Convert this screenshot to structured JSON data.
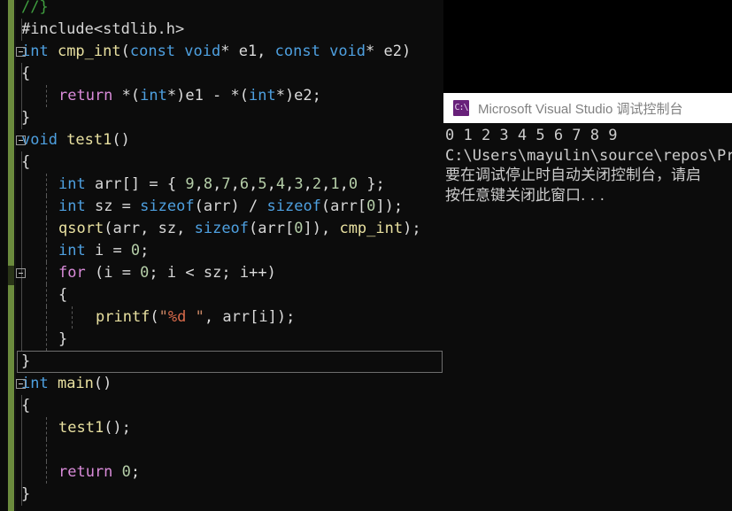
{
  "editor": {
    "name": "visual-studio-code-editor",
    "background": "#0c0c0c",
    "change_bar_color": "#6b8b3d",
    "lines": [
      {
        "id": "l01",
        "indent": 0,
        "fold": false,
        "guides": [],
        "current": false,
        "tokens": [
          {
            "t": "//}",
            "c": "c-comment"
          }
        ]
      },
      {
        "id": "l02",
        "indent": 0,
        "fold": false,
        "guides": [
          "g1"
        ],
        "current": false,
        "tokens": [
          {
            "t": "#include<stdlib.h>",
            "c": "c-pre"
          }
        ]
      },
      {
        "id": "l03",
        "indent": 0,
        "fold": true,
        "guides": [],
        "current": false,
        "tokens": [
          {
            "t": "int ",
            "c": "c-kw"
          },
          {
            "t": "cmp_int",
            "c": "c-fn"
          },
          {
            "t": "(",
            "c": "c-punc"
          },
          {
            "t": "const ",
            "c": "c-kw"
          },
          {
            "t": "void",
            "c": "c-kw"
          },
          {
            "t": "* e1, ",
            "c": "c-plain"
          },
          {
            "t": "const ",
            "c": "c-kw"
          },
          {
            "t": "void",
            "c": "c-kw"
          },
          {
            "t": "* e2)",
            "c": "c-plain"
          }
        ]
      },
      {
        "id": "l04",
        "indent": 0,
        "fold": false,
        "guides": [
          "g1"
        ],
        "current": false,
        "tokens": [
          {
            "t": "{",
            "c": "c-plain"
          }
        ]
      },
      {
        "id": "l05",
        "indent": 2,
        "fold": false,
        "guides": [
          "g1",
          "g2d"
        ],
        "current": false,
        "tokens": [
          {
            "t": "return ",
            "c": "c-ctrl"
          },
          {
            "t": "*(",
            "c": "c-plain"
          },
          {
            "t": "int",
            "c": "c-kw"
          },
          {
            "t": "*)e1 - *(",
            "c": "c-plain"
          },
          {
            "t": "int",
            "c": "c-kw"
          },
          {
            "t": "*)e2;",
            "c": "c-plain"
          }
        ]
      },
      {
        "id": "l06",
        "indent": 0,
        "fold": false,
        "guides": [
          "g1"
        ],
        "current": false,
        "tokens": [
          {
            "t": "}",
            "c": "c-plain"
          }
        ]
      },
      {
        "id": "l07",
        "indent": 0,
        "fold": true,
        "guides": [],
        "current": false,
        "tokens": [
          {
            "t": "void ",
            "c": "c-kw"
          },
          {
            "t": "test1",
            "c": "c-fn"
          },
          {
            "t": "()",
            "c": "c-plain"
          }
        ]
      },
      {
        "id": "l08",
        "indent": 0,
        "fold": false,
        "guides": [
          "g1"
        ],
        "current": false,
        "tokens": [
          {
            "t": "{",
            "c": "c-plain"
          }
        ]
      },
      {
        "id": "l09",
        "indent": 2,
        "fold": false,
        "guides": [
          "g1",
          "g2d"
        ],
        "current": false,
        "tokens": [
          {
            "t": "int ",
            "c": "c-kw"
          },
          {
            "t": "arr",
            "c": "c-var"
          },
          {
            "t": "[] = { ",
            "c": "c-plain"
          },
          {
            "t": "9",
            "c": "c-num"
          },
          {
            "t": ",",
            "c": "c-plain"
          },
          {
            "t": "8",
            "c": "c-num"
          },
          {
            "t": ",",
            "c": "c-plain"
          },
          {
            "t": "7",
            "c": "c-num"
          },
          {
            "t": ",",
            "c": "c-plain"
          },
          {
            "t": "6",
            "c": "c-num"
          },
          {
            "t": ",",
            "c": "c-plain"
          },
          {
            "t": "5",
            "c": "c-num"
          },
          {
            "t": ",",
            "c": "c-plain"
          },
          {
            "t": "4",
            "c": "c-num"
          },
          {
            "t": ",",
            "c": "c-plain"
          },
          {
            "t": "3",
            "c": "c-num"
          },
          {
            "t": ",",
            "c": "c-plain"
          },
          {
            "t": "2",
            "c": "c-num"
          },
          {
            "t": ",",
            "c": "c-plain"
          },
          {
            "t": "1",
            "c": "c-num"
          },
          {
            "t": ",",
            "c": "c-plain"
          },
          {
            "t": "0",
            "c": "c-num"
          },
          {
            "t": " };",
            "c": "c-plain"
          }
        ]
      },
      {
        "id": "l10",
        "indent": 2,
        "fold": false,
        "guides": [
          "g1",
          "g2d"
        ],
        "current": false,
        "tokens": [
          {
            "t": "int ",
            "c": "c-kw"
          },
          {
            "t": "sz",
            "c": "c-var"
          },
          {
            "t": " = ",
            "c": "c-plain"
          },
          {
            "t": "sizeof",
            "c": "c-kw"
          },
          {
            "t": "(",
            "c": "c-plain"
          },
          {
            "t": "arr",
            "c": "c-var"
          },
          {
            "t": ") / ",
            "c": "c-plain"
          },
          {
            "t": "sizeof",
            "c": "c-kw"
          },
          {
            "t": "(",
            "c": "c-plain"
          },
          {
            "t": "arr",
            "c": "c-var"
          },
          {
            "t": "[",
            "c": "c-plain"
          },
          {
            "t": "0",
            "c": "c-num"
          },
          {
            "t": "]);",
            "c": "c-plain"
          }
        ]
      },
      {
        "id": "l11",
        "indent": 2,
        "fold": false,
        "guides": [
          "g1",
          "g2d"
        ],
        "current": false,
        "tokens": [
          {
            "t": "qsort",
            "c": "c-fn"
          },
          {
            "t": "(",
            "c": "c-plain"
          },
          {
            "t": "arr",
            "c": "c-var"
          },
          {
            "t": ", ",
            "c": "c-plain"
          },
          {
            "t": "sz",
            "c": "c-var"
          },
          {
            "t": ", ",
            "c": "c-plain"
          },
          {
            "t": "sizeof",
            "c": "c-kw"
          },
          {
            "t": "(",
            "c": "c-plain"
          },
          {
            "t": "arr",
            "c": "c-var"
          },
          {
            "t": "[",
            "c": "c-plain"
          },
          {
            "t": "0",
            "c": "c-num"
          },
          {
            "t": "]), ",
            "c": "c-plain"
          },
          {
            "t": "cmp_int",
            "c": "c-fn"
          },
          {
            "t": ");",
            "c": "c-plain"
          }
        ]
      },
      {
        "id": "l12",
        "indent": 2,
        "fold": false,
        "guides": [
          "g1",
          "g2d"
        ],
        "current": false,
        "tokens": [
          {
            "t": "int ",
            "c": "c-kw"
          },
          {
            "t": "i",
            "c": "c-var"
          },
          {
            "t": " = ",
            "c": "c-plain"
          },
          {
            "t": "0",
            "c": "c-num"
          },
          {
            "t": ";",
            "c": "c-plain"
          }
        ]
      },
      {
        "id": "l13",
        "indent": 2,
        "fold": true,
        "guides": [
          "g1",
          "g2d"
        ],
        "current": false,
        "tokens": [
          {
            "t": "for ",
            "c": "c-ctrl"
          },
          {
            "t": "(",
            "c": "c-plain"
          },
          {
            "t": "i",
            "c": "c-var"
          },
          {
            "t": " = ",
            "c": "c-plain"
          },
          {
            "t": "0",
            "c": "c-num"
          },
          {
            "t": "; ",
            "c": "c-plain"
          },
          {
            "t": "i",
            "c": "c-var"
          },
          {
            "t": " < ",
            "c": "c-plain"
          },
          {
            "t": "sz",
            "c": "c-var"
          },
          {
            "t": "; ",
            "c": "c-plain"
          },
          {
            "t": "i",
            "c": "c-var"
          },
          {
            "t": "++)",
            "c": "c-plain"
          }
        ]
      },
      {
        "id": "l14",
        "indent": 2,
        "fold": false,
        "guides": [
          "g1",
          "g2d"
        ],
        "current": false,
        "tokens": [
          {
            "t": "{",
            "c": "c-plain"
          }
        ]
      },
      {
        "id": "l15",
        "indent": 4,
        "fold": false,
        "guides": [
          "g1",
          "g2d",
          "g3d"
        ],
        "current": false,
        "tokens": [
          {
            "t": "printf",
            "c": "c-fn"
          },
          {
            "t": "(",
            "c": "c-plain"
          },
          {
            "t": "\"",
            "c": "c-str"
          },
          {
            "t": "%d",
            "c": "c-fmt"
          },
          {
            "t": " \"",
            "c": "c-str"
          },
          {
            "t": ", ",
            "c": "c-plain"
          },
          {
            "t": "arr",
            "c": "c-var"
          },
          {
            "t": "[",
            "c": "c-plain"
          },
          {
            "t": "i",
            "c": "c-var"
          },
          {
            "t": "]);",
            "c": "c-plain"
          }
        ]
      },
      {
        "id": "l16",
        "indent": 2,
        "fold": false,
        "guides": [
          "g1",
          "g2d"
        ],
        "current": false,
        "tokens": [
          {
            "t": "}",
            "c": "c-plain"
          }
        ]
      },
      {
        "id": "l17",
        "indent": 0,
        "fold": false,
        "guides": [],
        "current": true,
        "tokens": [
          {
            "t": "}",
            "c": "c-plain"
          }
        ]
      },
      {
        "id": "l18",
        "indent": 0,
        "fold": true,
        "guides": [],
        "current": false,
        "tokens": [
          {
            "t": "int ",
            "c": "c-kw"
          },
          {
            "t": "main",
            "c": "c-fn"
          },
          {
            "t": "()",
            "c": "c-plain"
          }
        ]
      },
      {
        "id": "l19",
        "indent": 0,
        "fold": false,
        "guides": [
          "g1"
        ],
        "current": false,
        "tokens": [
          {
            "t": "{",
            "c": "c-plain"
          }
        ]
      },
      {
        "id": "l20",
        "indent": 2,
        "fold": false,
        "guides": [
          "g1",
          "g2d"
        ],
        "current": false,
        "tokens": [
          {
            "t": "test1",
            "c": "c-fn"
          },
          {
            "t": "();",
            "c": "c-plain"
          }
        ]
      },
      {
        "id": "l21",
        "indent": 0,
        "fold": false,
        "guides": [
          "g1",
          "g2d"
        ],
        "current": false,
        "tokens": [
          {
            "t": "",
            "c": "c-plain"
          }
        ]
      },
      {
        "id": "l22",
        "indent": 2,
        "fold": false,
        "guides": [
          "g1",
          "g2d"
        ],
        "current": false,
        "tokens": [
          {
            "t": "return ",
            "c": "c-ctrl"
          },
          {
            "t": "0",
            "c": "c-num"
          },
          {
            "t": ";",
            "c": "c-plain"
          }
        ]
      },
      {
        "id": "l23",
        "indent": 0,
        "fold": false,
        "guides": [
          "g1"
        ],
        "current": false,
        "tokens": [
          {
            "t": "}",
            "c": "c-plain"
          }
        ]
      }
    ]
  },
  "console": {
    "title": "Microsoft Visual Studio 调试控制台",
    "icon": "console-window-icon",
    "icon_color": "#68217a",
    "titlebar_color": "#ffffff",
    "background": "#0c0c0c",
    "output_lines": [
      {
        "id": "out1",
        "text": "0 1 2 3 4 5 6 7 8 9",
        "cjk": false
      },
      {
        "id": "out2",
        "text": "C:\\Users\\mayulin\\source\\repos\\Pro",
        "cjk": false
      },
      {
        "id": "out3",
        "text": "要在调试停止时自动关闭控制台，请启",
        "cjk": true
      },
      {
        "id": "out4",
        "text": "按任意键关闭此窗口. . .",
        "cjk": true
      }
    ]
  }
}
